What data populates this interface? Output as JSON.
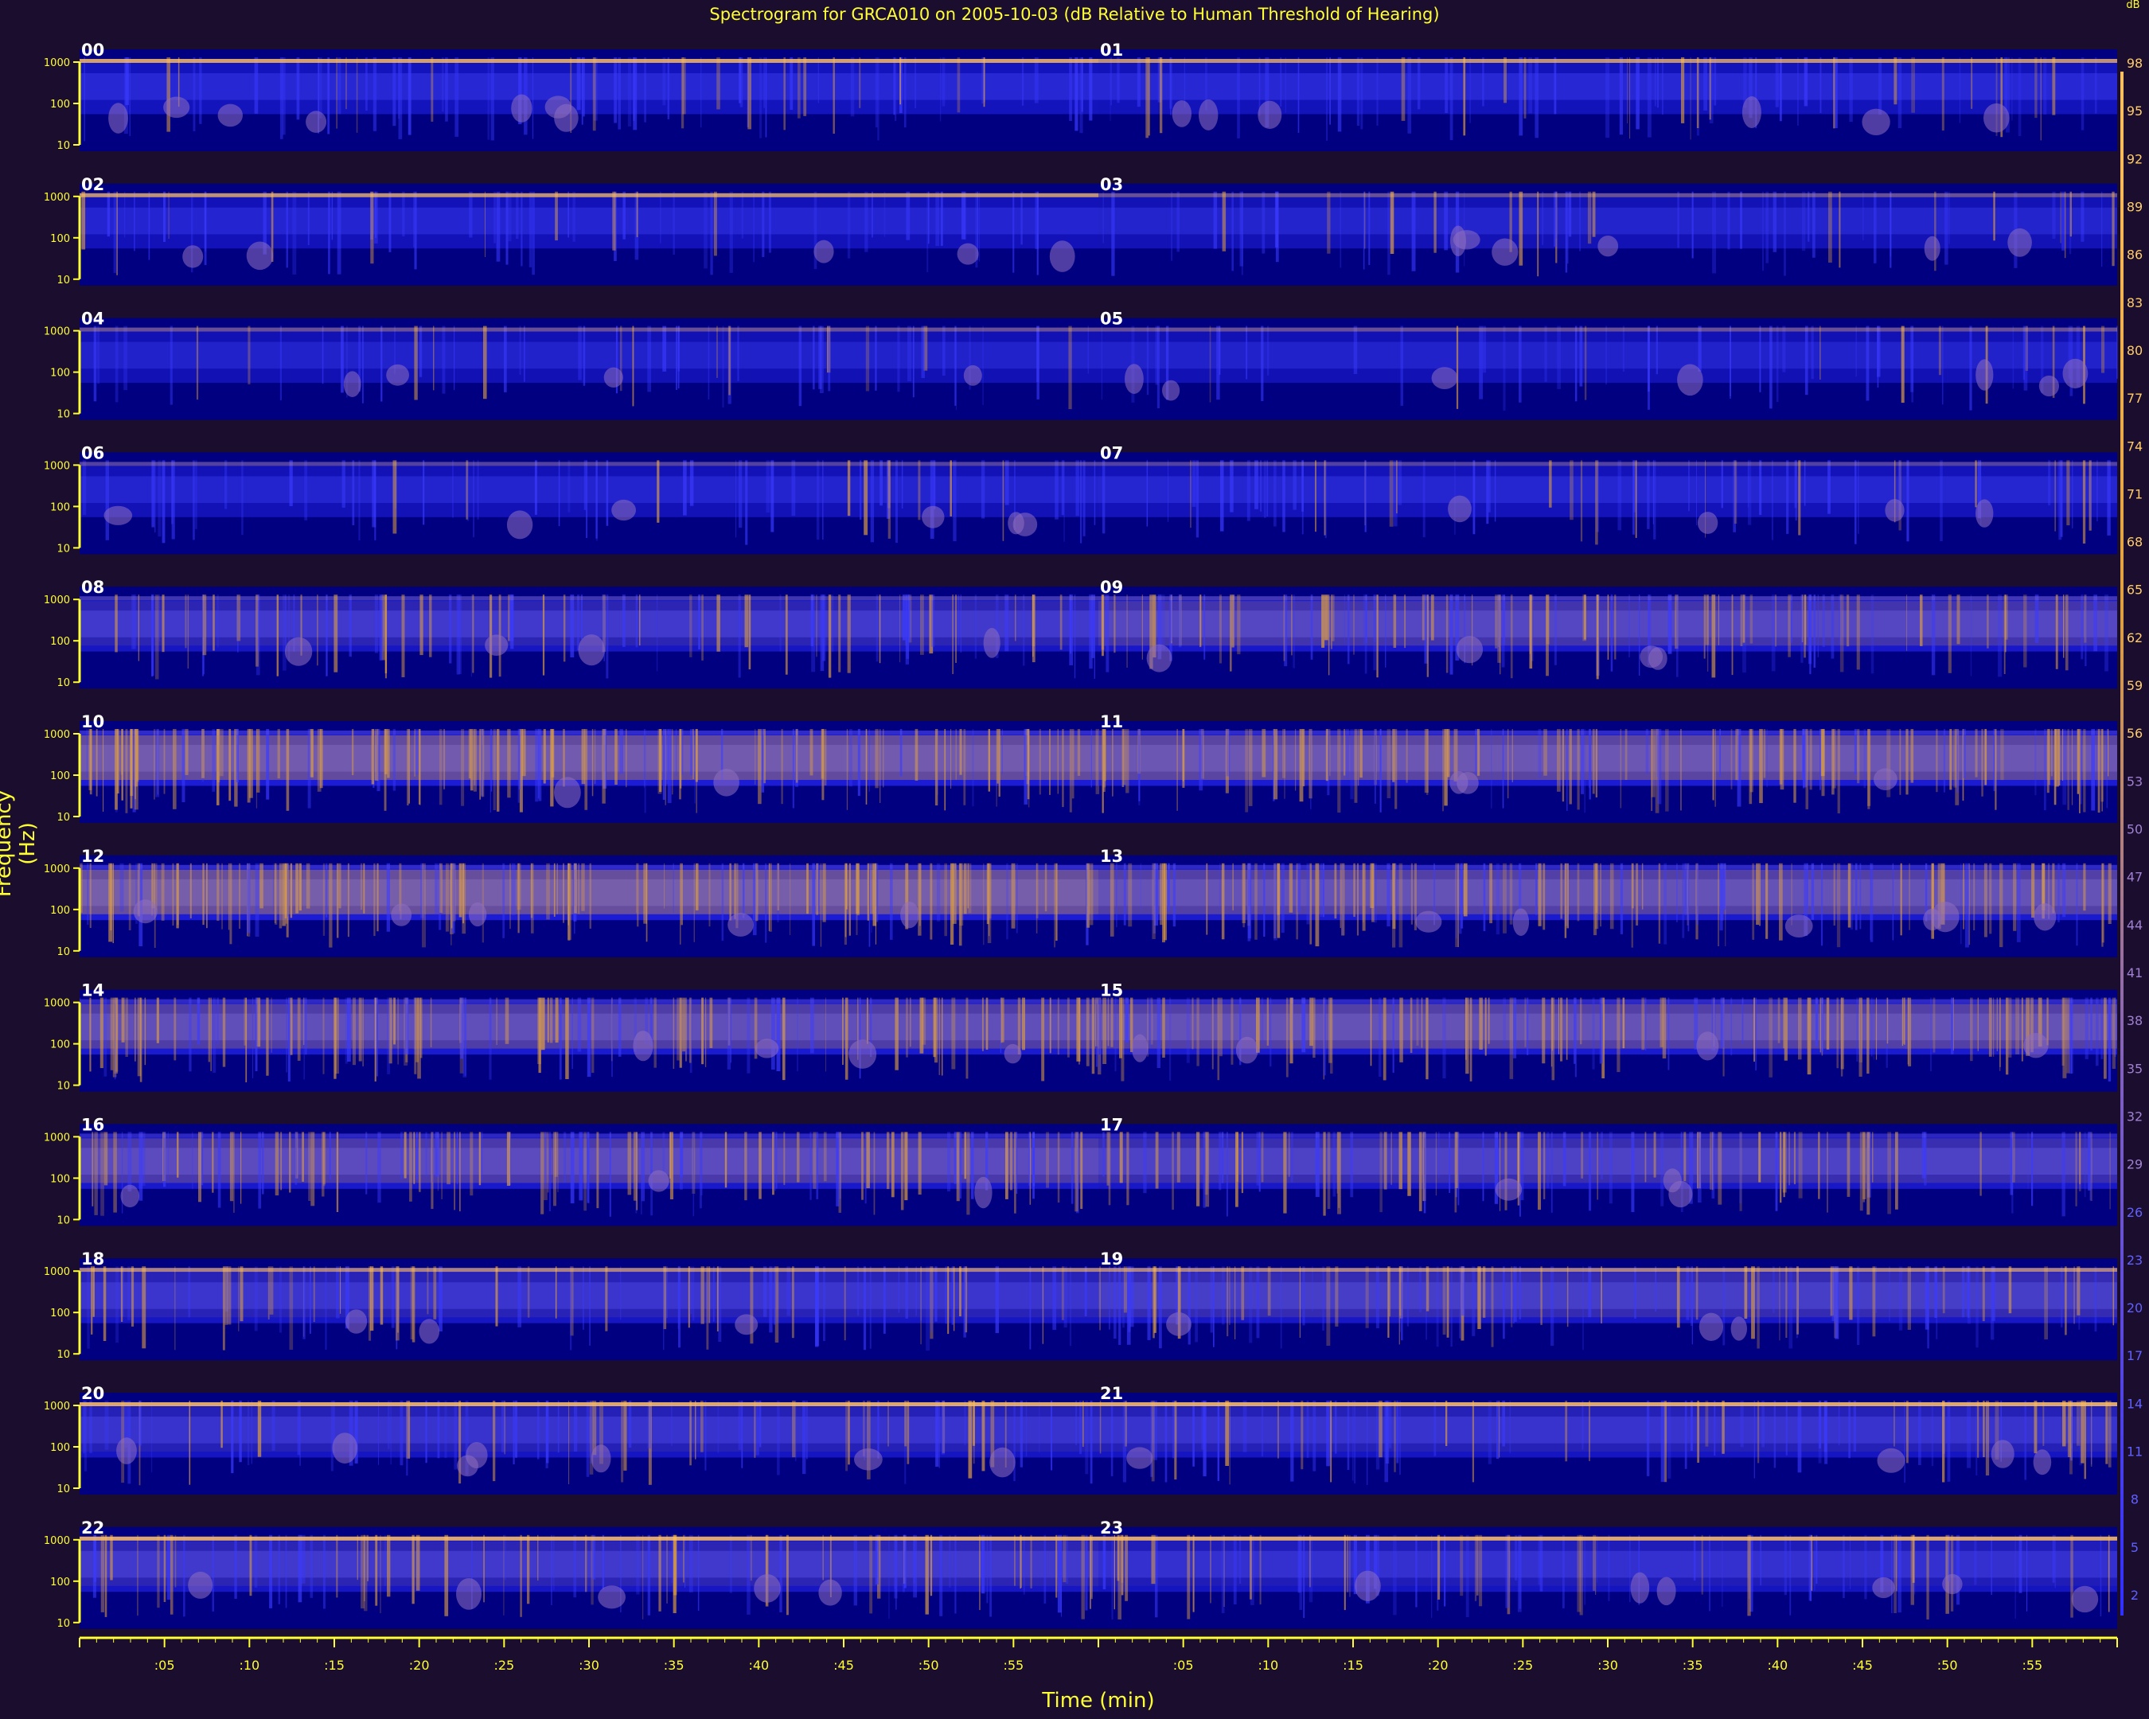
{
  "chart_data": {
    "type": "heatmap",
    "title": "Spectrogram for GRCA010 on 2005-10-03 (dB Relative to Human Threshold of Hearing)",
    "xlabel": "Time (min)",
    "ylabel": "Frequency (Hz)",
    "y_tick_labels": [
      "1000",
      "100",
      "10"
    ],
    "x_tick_labels": [
      ":05",
      ":10",
      ":15",
      ":20",
      ":25",
      ":30",
      ":35",
      ":40",
      ":45",
      ":50",
      ":55"
    ],
    "colorbar_label": "dB",
    "colorbar_ticks": [
      98,
      95,
      92,
      89,
      86,
      83,
      80,
      77,
      74,
      71,
      68,
      65,
      62,
      59,
      56,
      53,
      50,
      47,
      44,
      41,
      38,
      35,
      32,
      29,
      26,
      23,
      20,
      17,
      14,
      11,
      8,
      5,
      2
    ],
    "hours": [
      "00",
      "01",
      "02",
      "03",
      "04",
      "05",
      "06",
      "07",
      "08",
      "09",
      "10",
      "11",
      "12",
      "13",
      "14",
      "15",
      "16",
      "17",
      "18",
      "19",
      "20",
      "21",
      "22",
      "23"
    ],
    "hour_intensity": [
      0.3,
      0.28,
      0.22,
      0.18,
      0.14,
      0.14,
      0.2,
      0.26,
      0.45,
      0.58,
      0.78,
      0.72,
      0.8,
      0.68,
      0.66,
      0.68,
      0.62,
      0.52,
      0.42,
      0.5,
      0.4,
      0.4,
      0.45,
      0.38
    ],
    "tonal_band_strength": [
      0.9,
      0.8,
      0.8,
      0.4,
      0.4,
      0.4,
      0.3,
      0.3,
      0.2,
      0.2,
      0.1,
      0.1,
      0.1,
      0.1,
      0.1,
      0.1,
      0.1,
      0.1,
      0.7,
      0.7,
      0.95,
      0.95,
      0.95,
      0.95
    ],
    "colors": {
      "background": "#1a0d2e",
      "low": "#000080",
      "mid": "#2a2aff",
      "high": "#e0a040",
      "peak": "#ffc060",
      "axis": "#ffff33"
    }
  }
}
